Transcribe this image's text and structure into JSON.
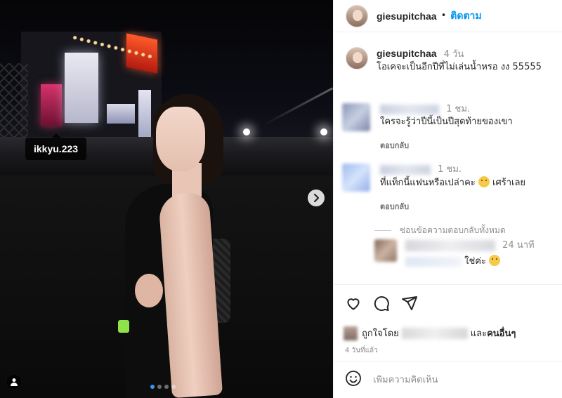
{
  "photo": {
    "tag_label": "ikkyu.223",
    "carousel": {
      "count": 4,
      "active": 1
    }
  },
  "header": {
    "username": "giesupitchaa",
    "separator": "•",
    "follow_label": "ติดตาม"
  },
  "caption": {
    "username": "giesupitchaa",
    "time": "4 วัน",
    "text": "โอเคจะเป็นอีกปีที่ไม่เล่นน้ำหรอ งง 55555"
  },
  "comments": [
    {
      "time": "1 ชม.",
      "text": "ใครจะรู้ว่าปีนี้เป็นปีสุดท้ายของเขา",
      "reply_label": "ตอบกลับ",
      "avatar_color": "#9aa6c7"
    },
    {
      "time": "1 ชม.",
      "text_before": "ที่แท็กนี้แฟนหรือเปล่าคะ",
      "text_after": " เศร้าเลย",
      "reply_label": "ตอบกลับ",
      "avatar_color": "#a9c3ee"
    }
  ],
  "hide_replies_label": "ซ่อนข้อความตอบกลับทั้งหมด",
  "reply": {
    "time": "24 นาที",
    "text": "ใช่ค่ะ",
    "avatar_color": "#a88d7d"
  },
  "actions": {
    "like_icon": "heart-icon",
    "comment_icon": "comment-icon",
    "share_icon": "share-icon"
  },
  "liked_by": {
    "prefix": "ถูกใจโดย",
    "middle": "และ",
    "others": "คนอื่นๆ"
  },
  "posted_ago": "4 วันที่แล้ว",
  "add_comment": {
    "placeholder": "เพิ่มความคิดเห็น"
  },
  "colors": {
    "accent": "#0095f6",
    "muted": "#8e8e8e",
    "text": "#262626"
  }
}
